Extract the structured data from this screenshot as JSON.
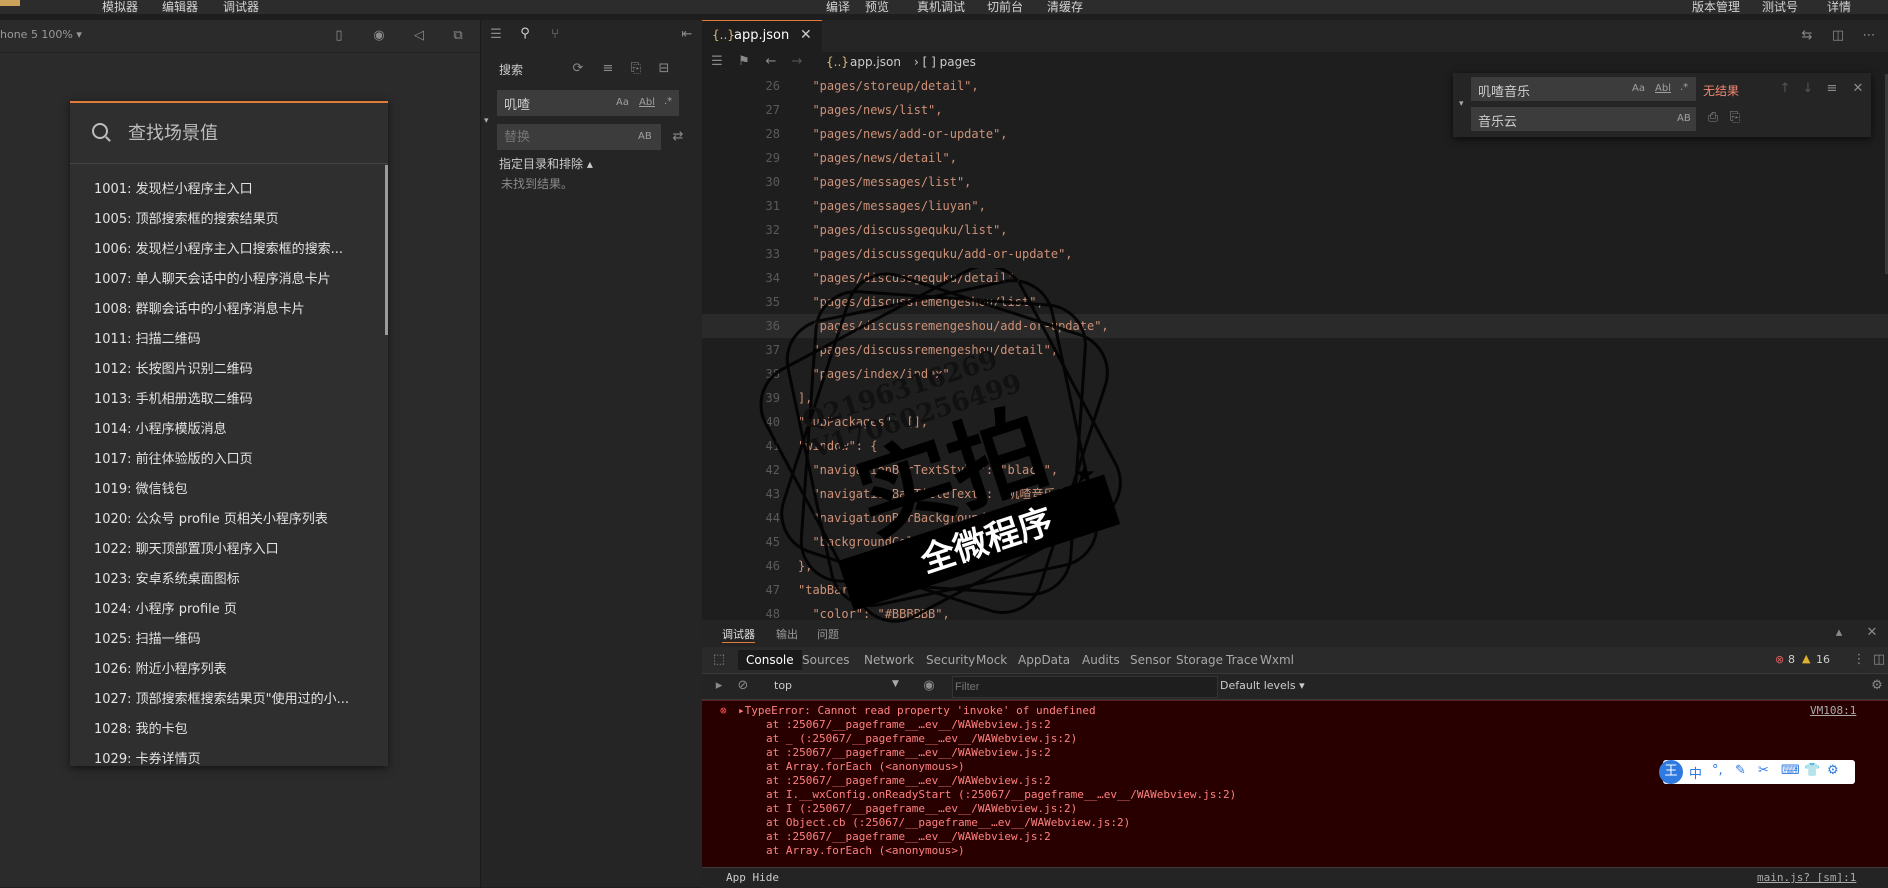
{
  "menubar": {
    "items": [
      "模拟器",
      "编辑器",
      "调试器"
    ],
    "center": [
      "编译",
      "预览",
      "真机调试",
      "切前台",
      "清缓存"
    ],
    "right": [
      "版本管理",
      "测试号",
      "详情"
    ]
  },
  "simulator": {
    "device_label": "hone 5 100% ▾",
    "search_placeholder": "查找场景值",
    "scenes": [
      "1001: 发现栏小程序主入口",
      "1005: 顶部搜索框的搜索结果页",
      "1006: 发现栏小程序主入口搜索框的搜索...",
      "1007: 单人聊天会话中的小程序消息卡片",
      "1008: 群聊会话中的小程序消息卡片",
      "1011: 扫描二维码",
      "1012: 长按图片识别二维码",
      "1013: 手机相册选取二维码",
      "1014: 小程序模版消息",
      "1017: 前往体验版的入口页",
      "1019: 微信钱包",
      "1020: 公众号 profile 页相关小程序列表",
      "1022: 聊天顶部置顶小程序入口",
      "1023: 安卓系统桌面图标",
      "1024: 小程序 profile 页",
      "1025: 扫描一维码",
      "1026: 附近小程序列表",
      "1027: 顶部搜索框搜索结果页\"使用过的小...",
      "1028: 我的卡包",
      "1029: 卡券详情页"
    ]
  },
  "search_panel": {
    "title": "搜索",
    "query": "叽喳",
    "replace_placeholder": "替换",
    "opt_case": "Aa",
    "opt_word": "Abl",
    "opt_regex": ".*",
    "opt_preserve": "AB",
    "dir_label": "指定目录和排除 ▴",
    "no_results": "未找到结果。"
  },
  "editor": {
    "tab_icon": "{..}",
    "tab_label": "app.json",
    "bc_file": "app.json",
    "bc_path": "› [ ] pages",
    "lines": [
      {
        "n": "26",
        "t": "  \"pages/storeup/detail\","
      },
      {
        "n": "27",
        "t": "  \"pages/news/list\","
      },
      {
        "n": "28",
        "t": "  \"pages/news/add-or-update\","
      },
      {
        "n": "29",
        "t": "  \"pages/news/detail\","
      },
      {
        "n": "30",
        "t": "  \"pages/messages/list\","
      },
      {
        "n": "31",
        "t": "  \"pages/messages/liuyan\","
      },
      {
        "n": "32",
        "t": "  \"pages/discussgequku/list\","
      },
      {
        "n": "33",
        "t": "  \"pages/discussgequku/add-or-update\","
      },
      {
        "n": "34",
        "t": "  \"pages/discussgequku/detail\","
      },
      {
        "n": "35",
        "t": "  \"pages/discussremengeshou/list\","
      },
      {
        "n": "36",
        "t": "  \"pages/discussremengeshou/add-or-update\","
      },
      {
        "n": "37",
        "t": "  \"pages/discussremengeshou/detail\","
      },
      {
        "n": "38",
        "t": "  \"pages/index/index\""
      },
      {
        "n": "39",
        "t": "],"
      },
      {
        "n": "40",
        "t": "\"subPackages\": [],"
      },
      {
        "n": "41",
        "t": "\"window\": {"
      },
      {
        "n": "42",
        "t": "  \"navigationBarTextStyle\": \"black\","
      },
      {
        "n": "43",
        "t": "  \"navigationBarTitleText\": \"叽喳音乐小程序\","
      },
      {
        "n": "44",
        "t": "  \"navigationBarBackgroundColor\": \"#FFFFFF\","
      },
      {
        "n": "45",
        "t": "  \"backgroundColor\": \"#FFFFFF\""
      },
      {
        "n": "46",
        "t": "},"
      },
      {
        "n": "47",
        "t": "\"tabBar\": {"
      },
      {
        "n": "48",
        "t": "  \"color\": \"#BBBBBB\","
      }
    ]
  },
  "find": {
    "query": "叽喳音乐",
    "replace": "音乐云",
    "result": "无结果",
    "opt_case": "Aa",
    "opt_word": "Abl",
    "opt_regex": ".*",
    "opt_preserve": "AB"
  },
  "debugger": {
    "tabs": [
      "调试器",
      "输出",
      "问题"
    ],
    "devtabs": [
      "Console",
      "Sources",
      "Network",
      "Security",
      "Mock",
      "AppData",
      "Audits",
      "Sensor",
      "Storage",
      "Trace",
      "Wxml"
    ],
    "error_count": "8",
    "warn_count": "16",
    "context": "top",
    "filter_placeholder": "Filter",
    "levels": "Default levels ▾",
    "error_title": "▸TypeError: Cannot read property 'invoke' of undefined",
    "error_source": "VM108:1",
    "stack": [
      "at :25067/__pageframe__…ev__/WAWebview.js:2",
      "at _ (:25067/__pageframe__…ev__/WAWebview.js:2)",
      "at :25067/__pageframe__…ev__/WAWebview.js:2",
      "at Array.forEach (<anonymous>)",
      "at :25067/__pageframe__…ev__/WAWebview.js:2",
      "at I.__wxConfig.onReadyStart (:25067/__pageframe__…ev__/WAWebview.js:2)",
      "at I (:25067/__pageframe__…ev__/WAWebview.js:2)",
      "at Object.cb (:25067/__pageframe__…ev__/WAWebview.js:2)",
      "at :25067/__pageframe__…ev__/WAWebview.js:2",
      "at Array.forEach (<anonymous>)"
    ],
    "status_left": "App Hide",
    "status_right": "main.js? [sm]:1"
  },
  "ime": {
    "items": [
      "王",
      "中",
      "°,",
      "✎",
      "✂",
      "⌨",
      "👕",
      "⚙"
    ]
  },
  "watermark": {
    "line1": "Q2196316269",
    "line2": "V17060256499",
    "big": "实拍",
    "banner": "全微程序"
  },
  "colors": {
    "accent": "#e07b39",
    "error_bg": "#290000",
    "error_text": "#ff8080"
  }
}
